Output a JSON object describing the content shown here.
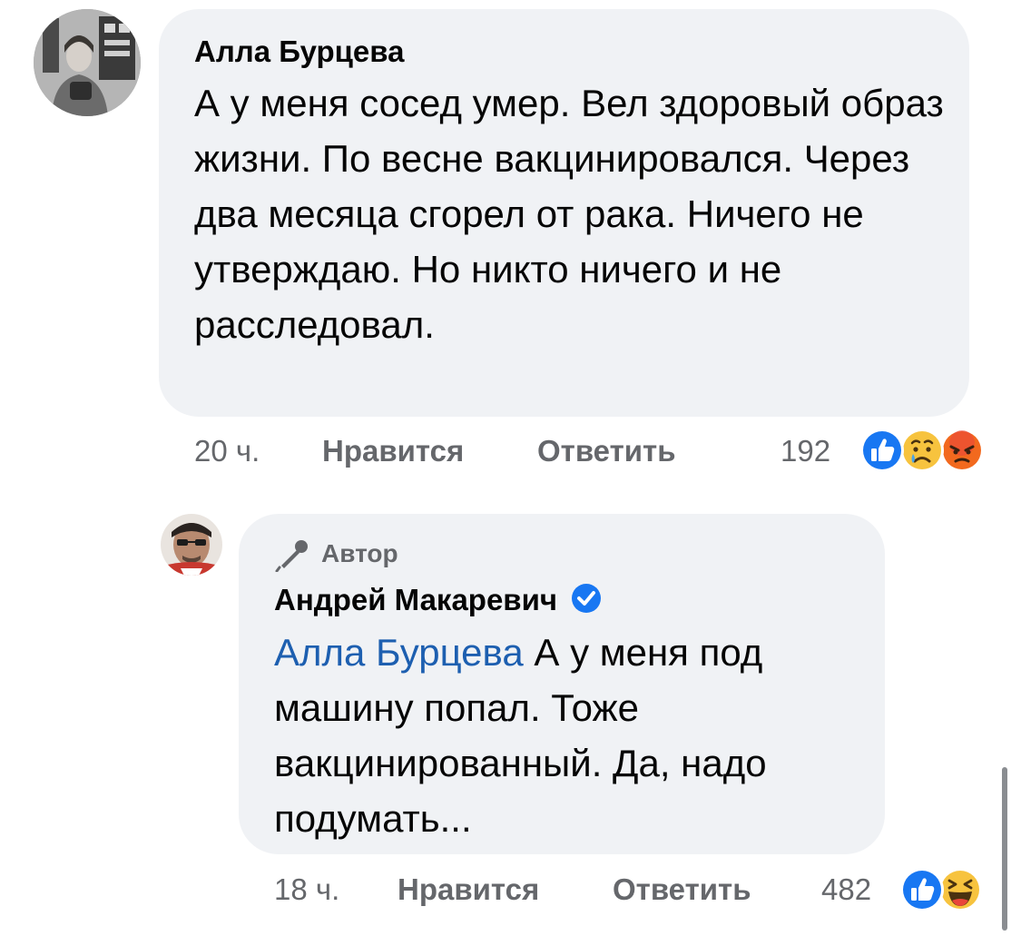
{
  "comments": [
    {
      "author": "Алла Бурцева",
      "text": "А у меня сосед умер. Вел здоровый образ жизни. По весне вакцинировался. Через два месяца сгорел от рака. Ничего не утверждаю. Но никто ничего и не расследовал.",
      "time": "20 ч.",
      "like_label": "Нравится",
      "reply_label": "Ответить",
      "reaction_count": "192",
      "reactions": [
        "like-icon",
        "sad-icon",
        "angry-icon"
      ]
    }
  ],
  "reply": {
    "badge": "Автор",
    "author": "Андрей Макаревич",
    "verified": true,
    "mention": "Алла Бурцева",
    "text": "А у меня под машину попал. Тоже вакцинированный. Да, надо подумать...",
    "time": "18 ч.",
    "like_label": "Нравится",
    "reply_label": "Ответить",
    "reaction_count": "482",
    "reactions": [
      "like-icon",
      "haha-icon"
    ]
  },
  "colors": {
    "bubble": "#f0f2f5",
    "mention": "#1d5fb0",
    "meta": "#65676b",
    "like": "#1877f2",
    "verified": "#1877f2"
  }
}
